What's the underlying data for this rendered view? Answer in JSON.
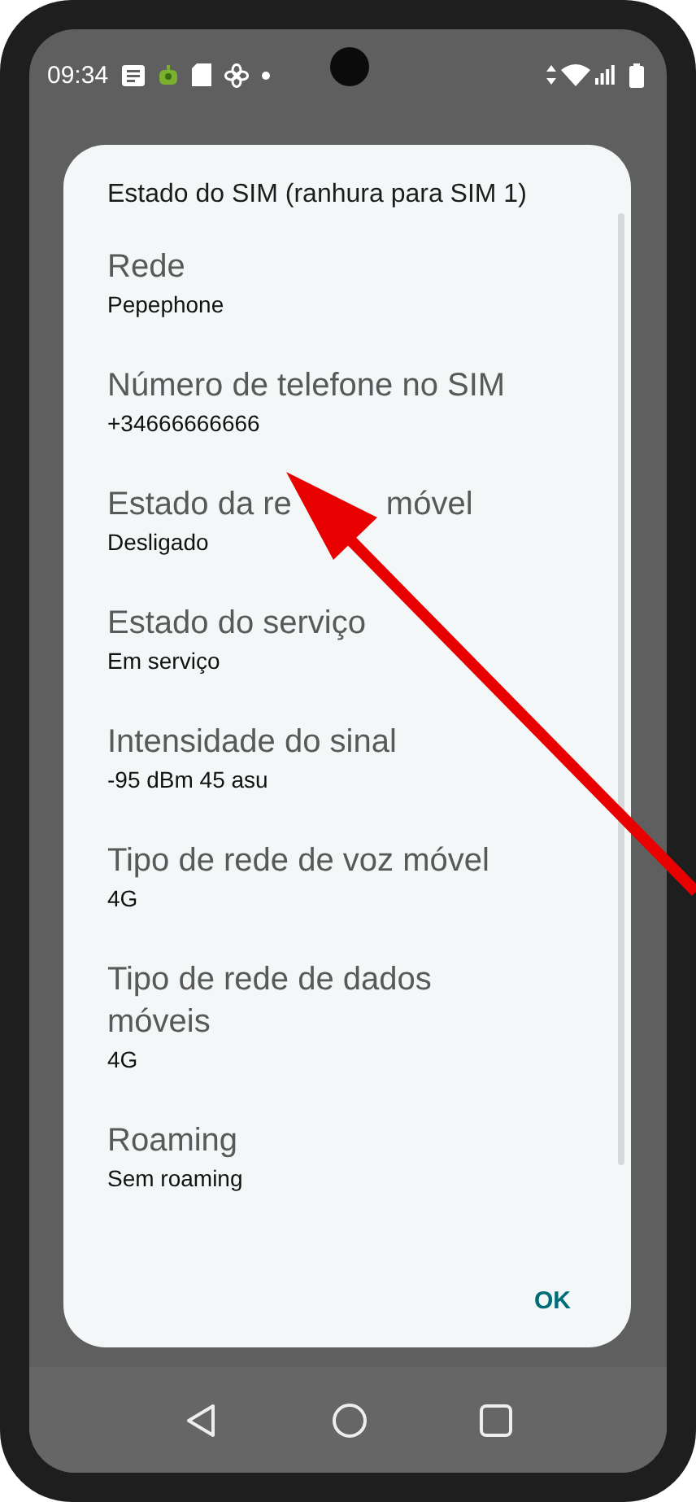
{
  "status_bar": {
    "time": "09:34"
  },
  "dialog": {
    "title": "Estado do SIM (ranhura para SIM 1)",
    "items": [
      {
        "label": "Rede",
        "value": "Pepephone"
      },
      {
        "label": "Número de telefone no SIM",
        "value": "+34666666666"
      },
      {
        "label_fragments": [
          "Estado da re",
          "móvel"
        ],
        "value": "Desligado"
      },
      {
        "label": "Estado do serviço",
        "value": "Em serviço"
      },
      {
        "label": "Intensidade do sinal",
        "value": "-95 dBm 45 asu"
      },
      {
        "label": "Tipo de rede de voz móvel",
        "value": "4G"
      },
      {
        "label": "Tipo de rede de dados móveis",
        "value": "4G"
      },
      {
        "label": "Roaming",
        "value": "Sem roaming"
      }
    ],
    "button": "OK"
  }
}
